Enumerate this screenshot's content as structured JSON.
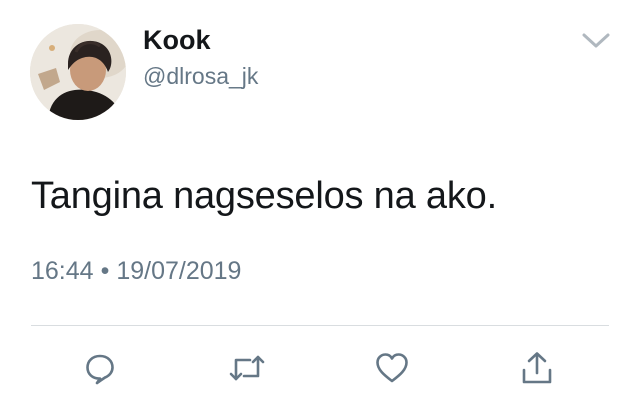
{
  "tweet": {
    "author": {
      "display_name": "Kook",
      "handle": "@dlrosa_jk"
    },
    "text": "Tangina nagseselos na ako.",
    "time": "16:44",
    "separator": "•",
    "date": "19/07/2019"
  },
  "icons": {
    "menu": "chevron-down-icon",
    "reply": "speech-bubble-icon",
    "retweet": "retweet-arrows-icon",
    "like": "heart-icon",
    "share": "share-upload-icon"
  },
  "colors": {
    "text_primary": "#14171a",
    "text_secondary": "#657786",
    "icon": "#657786",
    "divider": "#d9dde0"
  }
}
